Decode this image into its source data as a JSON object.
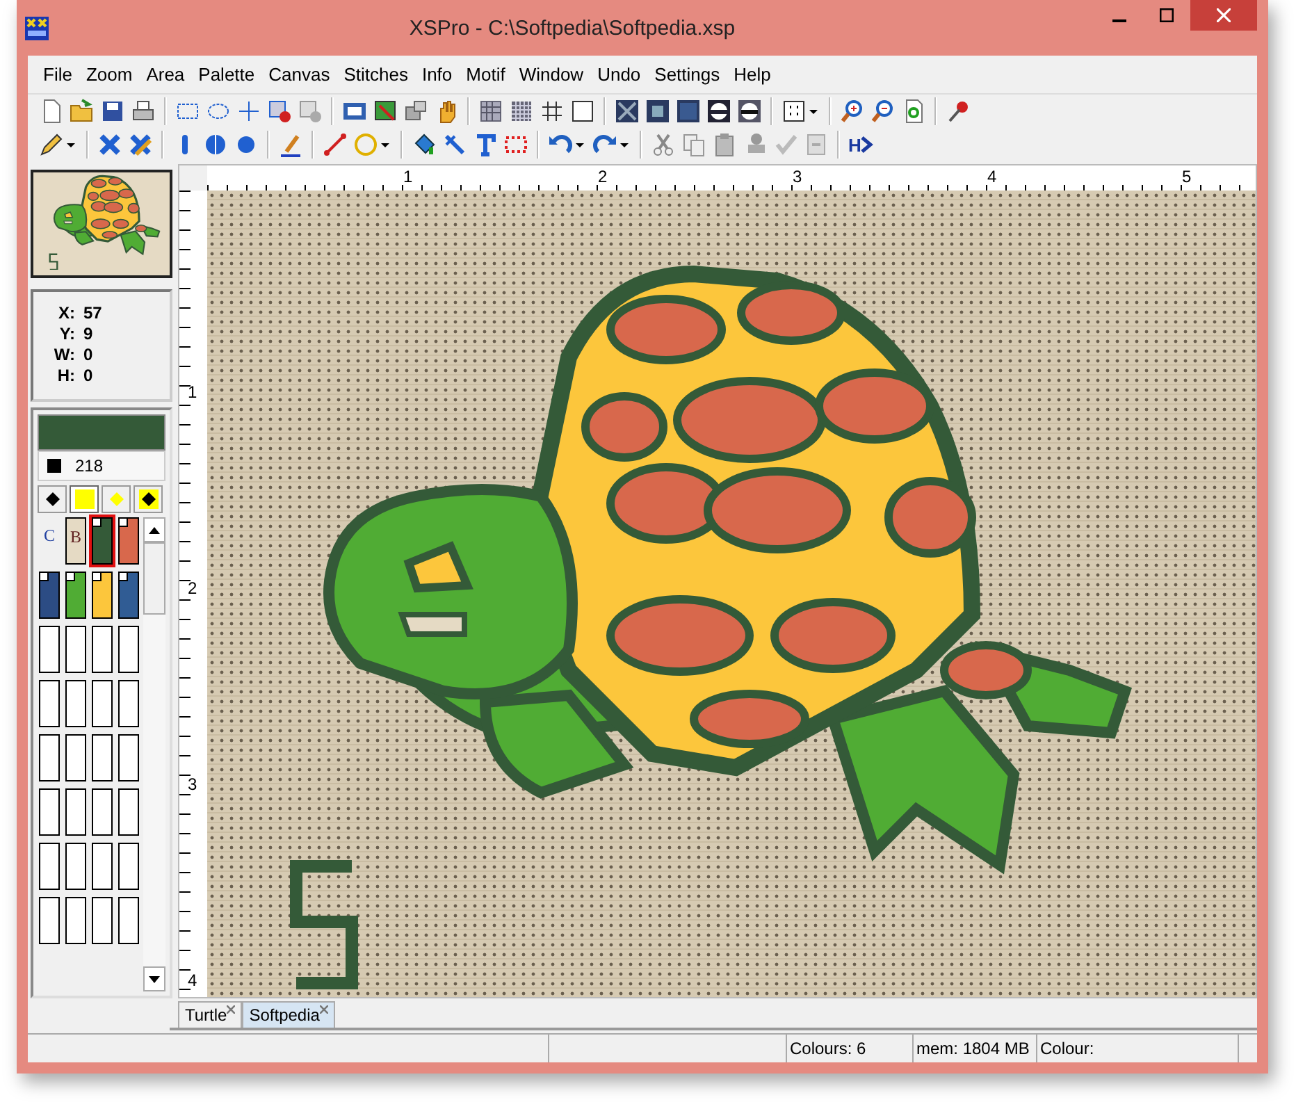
{
  "window": {
    "title": "XSPro - C:\\Softpedia\\Softpedia.xsp"
  },
  "menu": [
    "File",
    "Zoom",
    "Area",
    "Palette",
    "Canvas",
    "Stitches",
    "Info",
    "Motif",
    "Window",
    "Undo",
    "Settings",
    "Help"
  ],
  "toolbar": {
    "h_button": "H"
  },
  "ruler": {
    "horizontal": [
      "1",
      "2",
      "3",
      "4",
      "5"
    ],
    "vertical": [
      "1",
      "2",
      "3",
      "4"
    ]
  },
  "coordinates": [
    {
      "label": "X:",
      "value": "57"
    },
    {
      "label": "Y:",
      "value": "9"
    },
    {
      "label": "W:",
      "value": "0"
    },
    {
      "label": "H:",
      "value": "0"
    }
  ],
  "current_colour": {
    "color": "#345a38",
    "number": "218"
  },
  "palette_tabs": [
    {
      "kind": "black",
      "selected": false
    },
    {
      "kind": "yellow",
      "selected": true
    },
    {
      "kind": "yellow-diamond",
      "selected": false
    },
    {
      "kind": "black-on-yellow",
      "selected": false
    }
  ],
  "palette_headers": [
    "C",
    "B"
  ],
  "swatches": [
    {
      "kind": "background",
      "color": "#e5dac4",
      "selected": false
    },
    {
      "kind": "thread",
      "color": "#345a38",
      "selected": true
    },
    {
      "kind": "thread",
      "color": "#d8684c",
      "selected": false
    },
    {
      "kind": "thread",
      "color": "#2c4c84",
      "selected": false
    },
    {
      "kind": "thread",
      "color": "#50ac34",
      "selected": false
    },
    {
      "kind": "thread",
      "color": "#fcc63c",
      "selected": false
    },
    {
      "kind": "thread",
      "color": "#305c94",
      "selected": false
    }
  ],
  "document_tabs": [
    {
      "label": "Turtle",
      "selected": false
    },
    {
      "label": "Softpedia",
      "selected": true
    }
  ],
  "status_bar": [
    "Colours: 6",
    "mem: 1804 MB",
    "Colour:"
  ]
}
